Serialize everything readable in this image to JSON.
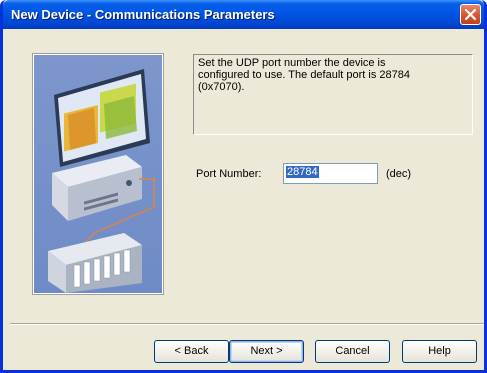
{
  "window": {
    "title": "New Device - Communications Parameters"
  },
  "info": {
    "lines": [
      "Set the UDP port number the device is",
      "configured to use.  The  default port is 28784",
      "(0x7070)."
    ]
  },
  "port": {
    "label": "Port Number:",
    "value": "28784",
    "unit": "(dec)"
  },
  "buttons": {
    "back": "< Back",
    "next": "Next >",
    "cancel": "Cancel",
    "help": "Help"
  },
  "colors": {
    "titlebar": "#0058e6",
    "dialog_bg": "#ece9d8",
    "illustration_bg": "#7d97cc",
    "selection": "#316ac5"
  },
  "icons": {
    "close": "close-icon",
    "illustration": "computer-network-illustration"
  }
}
